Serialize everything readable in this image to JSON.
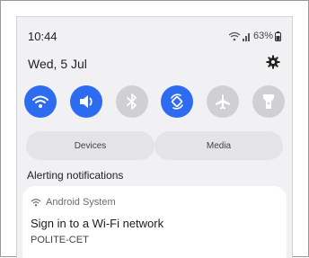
{
  "status_bar": {
    "time": "10:44",
    "battery_percent": "63%"
  },
  "header": {
    "date": "Wed, 5 Jul"
  },
  "quick_toggles": [
    {
      "icon": "wifi-icon",
      "state": "on"
    },
    {
      "icon": "volume-icon",
      "state": "on"
    },
    {
      "icon": "bluetooth-icon",
      "state": "off"
    },
    {
      "icon": "auto-rotate-icon",
      "state": "on"
    },
    {
      "icon": "airplane-icon",
      "state": "off"
    },
    {
      "icon": "flashlight-icon",
      "state": "off"
    }
  ],
  "panel_buttons": {
    "devices_label": "Devices",
    "media_label": "Media"
  },
  "notifications": {
    "section_label": "Alerting notifications",
    "items": [
      {
        "app": "Android System",
        "title": "Sign in to a Wi-Fi network",
        "subtitle": "POLITE-CET"
      }
    ]
  },
  "colors": {
    "toggle_on": "#2d6bf0",
    "toggle_off": "#cfcfd4",
    "panel_bg": "#f1f1f4"
  }
}
